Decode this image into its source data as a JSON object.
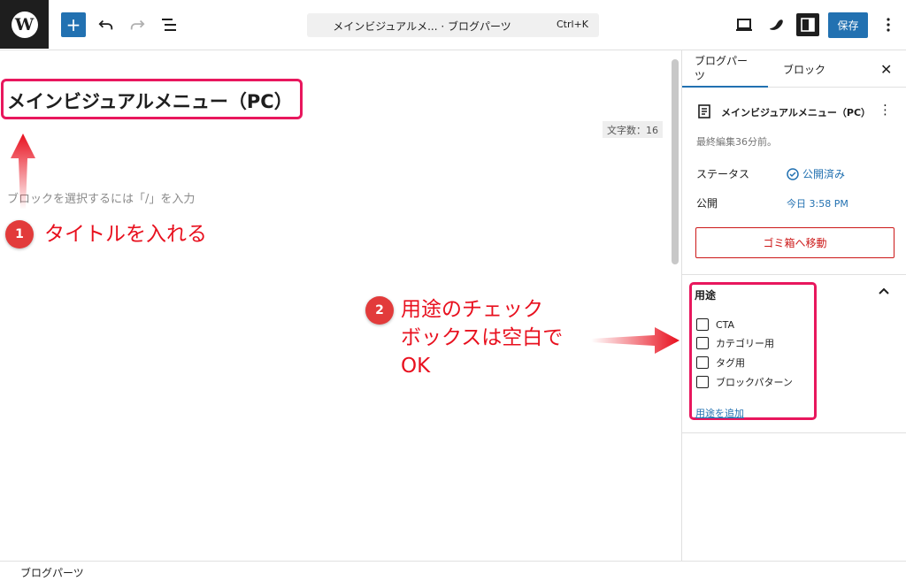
{
  "toolbar": {
    "wp_logo": "W",
    "add_label": "+",
    "command_text": "メインビジュアルメ... · ブログパーツ",
    "command_shortcut": "Ctrl+K",
    "save_label": "保存",
    "icons": [
      "wordpress-icon",
      "plus-icon",
      "undo-icon",
      "redo-icon",
      "list-view-icon",
      "desktop-view-icon",
      "styles-icon",
      "sidebar-toggle-icon",
      "kebab-icon"
    ]
  },
  "editor": {
    "title": "メインビジュアルメニュー（PC）",
    "char_count": "文字数：16",
    "block_placeholder": "ブロックを選択するには「/」を入力"
  },
  "annotations": [
    {
      "num": "1",
      "text": "タイトルを入れる"
    },
    {
      "num": "2",
      "text_lines": [
        "用途のチェック",
        "ボックスは空白で",
        "OK"
      ]
    }
  ],
  "sidebar": {
    "tabs": [
      {
        "label": "ブログパーツ",
        "active": true
      },
      {
        "label": "ブロック",
        "active": false
      }
    ],
    "close_label": "✕",
    "doc_title": "メインビジュアルメニュー（PC）",
    "last_edited": "最終編集36分前。",
    "status_label": "ステータス",
    "status_value": "公開済み",
    "publish_label": "公開",
    "publish_value": "今日 3:58 PM",
    "trash_label": "ゴミ箱へ移動",
    "usage": {
      "title": "用途",
      "options": [
        {
          "label": "CTA",
          "checked": false
        },
        {
          "label": "カテゴリー用",
          "checked": false
        },
        {
          "label": "タグ用",
          "checked": false
        },
        {
          "label": "ブロックパターン",
          "checked": false
        }
      ],
      "add_label": "用途を追加"
    }
  },
  "footer": {
    "breadcrumb": "ブログパーツ"
  },
  "colors": {
    "accent": "#2271b1",
    "annotation": "#e8101e",
    "highlight_border": "#e8175d",
    "danger": "#cc1818"
  }
}
